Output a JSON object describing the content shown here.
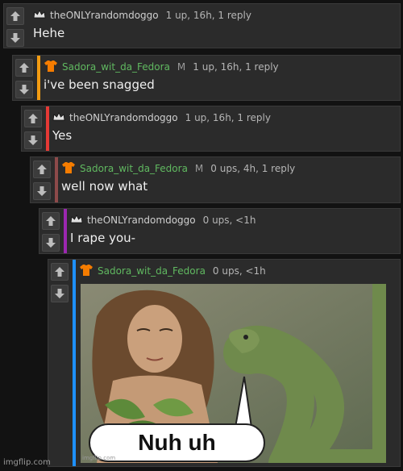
{
  "comments": [
    {
      "user": "theONLYrandomdoggo",
      "user_icon": "crown-icon",
      "stats": "1 up, 16h, 1 reply",
      "text": "Hehe",
      "bar_color": ""
    },
    {
      "user": "Sadora_wit_da_Fedora",
      "user_icon": "orange-tshirt-icon",
      "mod": "M",
      "stats": "1 up, 16h, 1 reply",
      "text": "i've been snagged",
      "bar_color": "#f39c12"
    },
    {
      "user": "theONLYrandomdoggo",
      "user_icon": "crown-icon",
      "stats": "1 up, 16h, 1 reply",
      "text": "Yes",
      "bar_color": "#e53935"
    },
    {
      "user": "Sadora_wit_da_Fedora",
      "user_icon": "orange-tshirt-icon",
      "mod": "M",
      "stats": "0 ups, 4h, 1 reply",
      "text": "well now what",
      "bar_color": "#8d4a4a"
    },
    {
      "user": "theONLYrandomdoggo",
      "user_icon": "crown-icon",
      "stats": "0 ups, <1h",
      "text": "I rape you-",
      "bar_color": "#9c27b0"
    },
    {
      "user": "Sadora_wit_da_Fedora",
      "user_icon": "orange-tshirt-icon",
      "stats": "0 ups, <1h",
      "text": "",
      "bar_color": "#1e90ff",
      "image": {
        "caption": "Nuh uh",
        "watermark": "imgflip.com"
      }
    }
  ],
  "footer": {
    "watermark": "imgflip.com"
  },
  "colors": {
    "owner_name": "#60b860",
    "background": "#121212",
    "panel": "#2b2b2b"
  }
}
